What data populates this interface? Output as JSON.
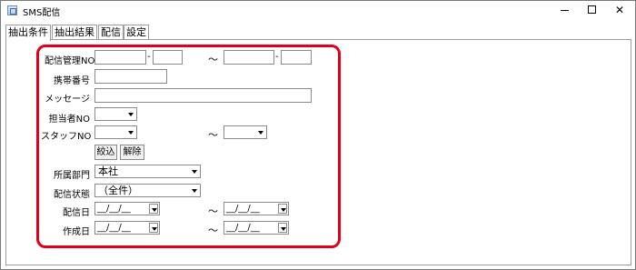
{
  "window": {
    "title": "SMS配信",
    "minimize_icon": "minimize-icon",
    "maximize_icon": "maximize-icon",
    "close_icon": "close-icon",
    "close_glyph": "✕"
  },
  "tabs": [
    {
      "label": "抽出条件",
      "active": true
    },
    {
      "label": "抽出結果",
      "active": false
    },
    {
      "label": "配信",
      "active": false
    },
    {
      "label": "設定",
      "active": false
    }
  ],
  "form": {
    "delivery_no": {
      "label": "配信管理NO",
      "sep": "-",
      "tilde": "～",
      "from1": "",
      "from2": "",
      "to1": "",
      "to2": ""
    },
    "mobile": {
      "label": "携帯番号",
      "value": ""
    },
    "message": {
      "label": "メッセージ",
      "value": ""
    },
    "person_no": {
      "label": "担当者NO",
      "value": ""
    },
    "staff_no": {
      "label": "スタッフNO",
      "tilde": "～",
      "from": "",
      "to": ""
    },
    "buttons": {
      "filter": "絞込",
      "clear": "解除"
    },
    "department": {
      "label": "所属部門",
      "value": "本社"
    },
    "status": {
      "label": "配信状態",
      "value": "（全件）"
    },
    "delivery_date": {
      "label": "配信日",
      "tilde": "～",
      "from": "__/__/__",
      "to": "__/__/__"
    },
    "created_date": {
      "label": "作成日",
      "tilde": "～",
      "from": "__/__/__",
      "to": "__/__/__"
    }
  },
  "colors": {
    "highlight": "#e0001a"
  }
}
